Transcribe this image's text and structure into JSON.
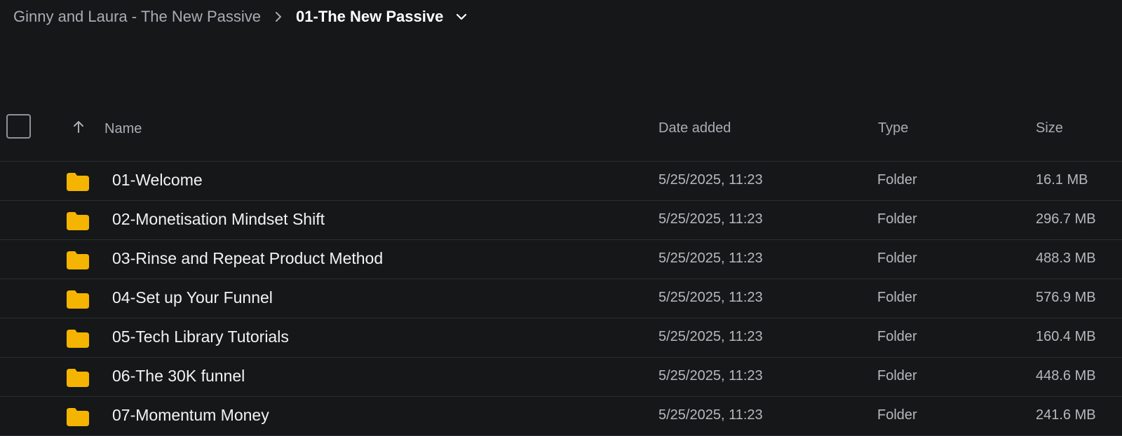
{
  "breadcrumb": {
    "parent": "Ginny and Laura - The New Passive",
    "current": "01-The New Passive"
  },
  "columns": {
    "name": "Name",
    "date_added": "Date added",
    "type": "Type",
    "size": "Size"
  },
  "rows": [
    {
      "name": "01-Welcome",
      "date": "5/25/2025, 11:23",
      "type": "Folder",
      "size": "16.1 MB"
    },
    {
      "name": "02-Monetisation Mindset Shift",
      "date": "5/25/2025, 11:23",
      "type": "Folder",
      "size": "296.7 MB"
    },
    {
      "name": "03-Rinse and Repeat Product Method",
      "date": "5/25/2025, 11:23",
      "type": "Folder",
      "size": "488.3 MB"
    },
    {
      "name": "04-Set up Your Funnel",
      "date": "5/25/2025, 11:23",
      "type": "Folder",
      "size": "576.9 MB"
    },
    {
      "name": "05-Tech Library Tutorials",
      "date": "5/25/2025, 11:23",
      "type": "Folder",
      "size": "160.4 MB"
    },
    {
      "name": "06-The 30K funnel",
      "date": "5/25/2025, 11:23",
      "type": "Folder",
      "size": "448.6 MB"
    },
    {
      "name": "07-Momentum Money",
      "date": "5/25/2025, 11:23",
      "type": "Folder",
      "size": "241.6 MB"
    }
  ],
  "colors": {
    "background": "#151718",
    "folder": "#f5b400",
    "divider": "#2b2e31"
  },
  "icons": {
    "breadcrumb_separator": "chevron-right-icon",
    "breadcrumb_menu": "chevron-down-icon",
    "sort": "arrow-up-icon",
    "row": "folder-icon"
  }
}
